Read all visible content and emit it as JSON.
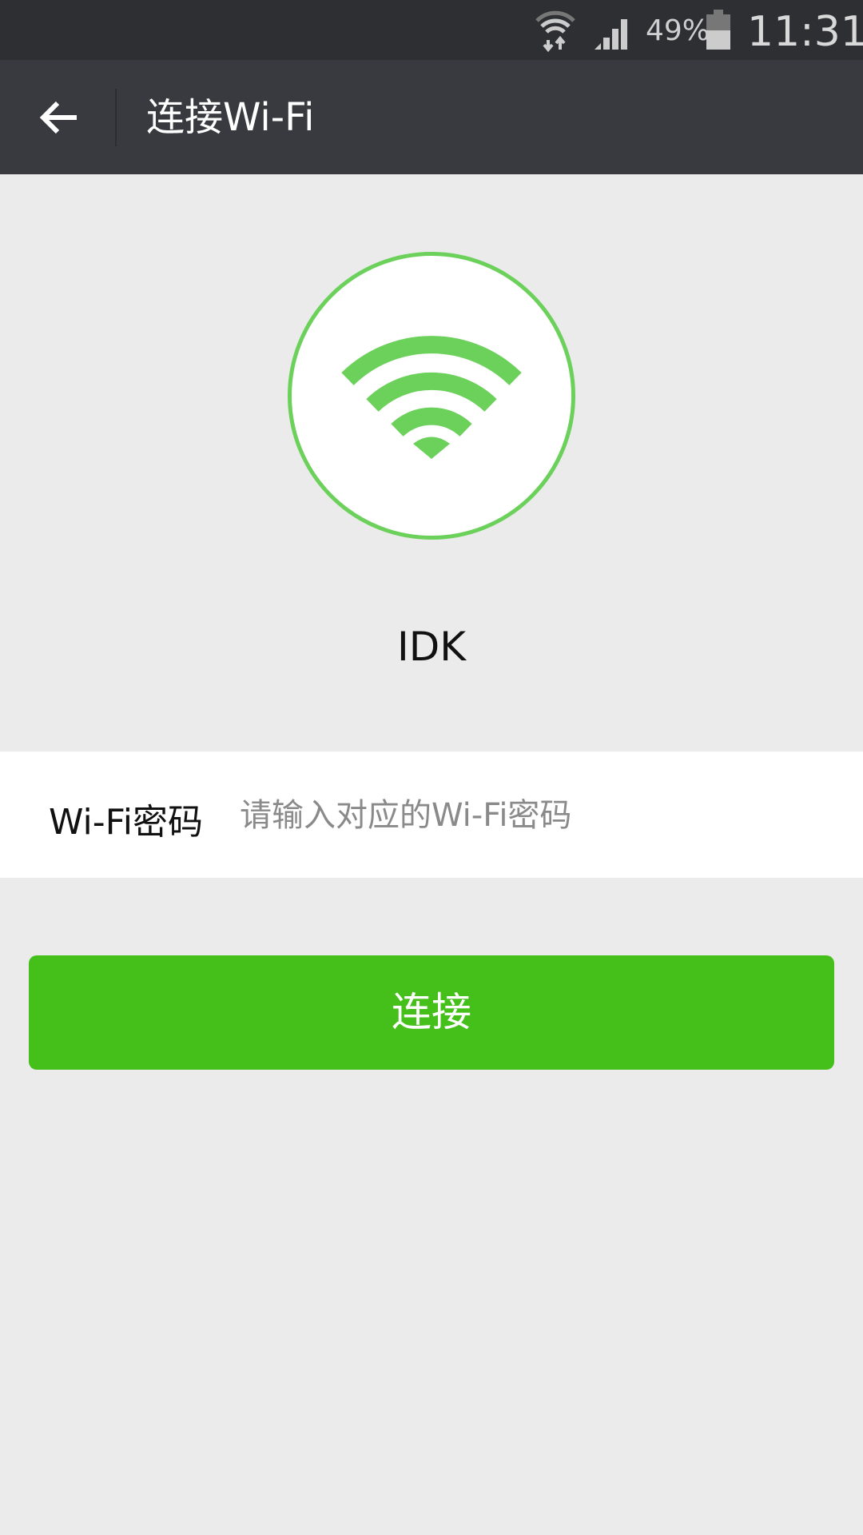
{
  "status_bar": {
    "battery_percent": "49%",
    "battery_level": 49,
    "time": "11:31",
    "icons": [
      "wifi-data-icon",
      "signal-icon",
      "battery-icon"
    ]
  },
  "header": {
    "title": "连接Wi-Fi",
    "back_icon": "arrow-left-icon"
  },
  "wifi": {
    "ssid": "IDK",
    "icon": "wifi-icon",
    "accent": "#6bd15a"
  },
  "password": {
    "label": "Wi-Fi密码",
    "placeholder": "请输入对应的Wi-Fi密码",
    "value": ""
  },
  "connect_button": {
    "label": "连接",
    "color": "#45c01a"
  }
}
